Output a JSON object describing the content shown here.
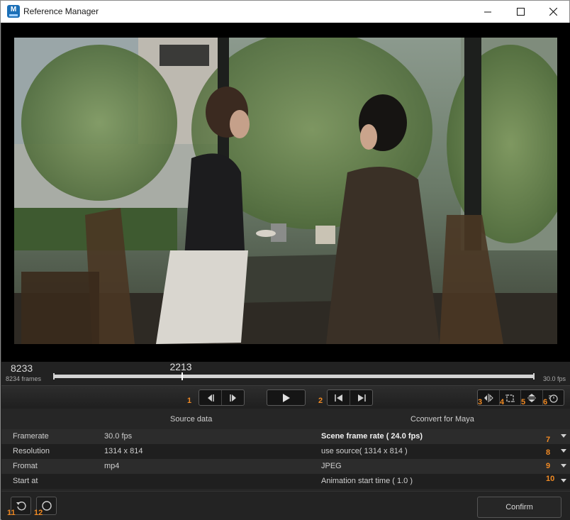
{
  "window": {
    "title": "Reference Manager",
    "app_icon": "maya-app-icon"
  },
  "timeline": {
    "total_frames_display": "8233",
    "frame_count_label": "8234 frames",
    "current_frame": "2213",
    "current_fraction": 0.2687,
    "fps_label": "30.0 fps"
  },
  "annotations": {
    "n1": "1",
    "n2": "2",
    "n3": "3",
    "n4": "4",
    "n5": "5",
    "n6": "6",
    "n7": "7",
    "n8": "8",
    "n9": "9",
    "n10": "10",
    "n11": "11",
    "n12": "12"
  },
  "table": {
    "source_header": "Source data",
    "convert_header": "Cconvert for Maya",
    "rows": [
      {
        "label": "Framerate",
        "source": "30.0 fps",
        "convert": "Scene frame rate ( 24.0 fps)"
      },
      {
        "label": "Resolution",
        "source": "1314 x 814",
        "convert": "use source( 1314 x 814 )"
      },
      {
        "label": "Fromat",
        "source": "mp4",
        "convert": "JPEG"
      },
      {
        "label": "Start at",
        "source": "",
        "convert": "Animation start time ( 1.0 )"
      }
    ]
  },
  "footer": {
    "confirm_label": "Confirm"
  },
  "colors": {
    "accent_number": "#f08a24",
    "background": "#232323"
  }
}
